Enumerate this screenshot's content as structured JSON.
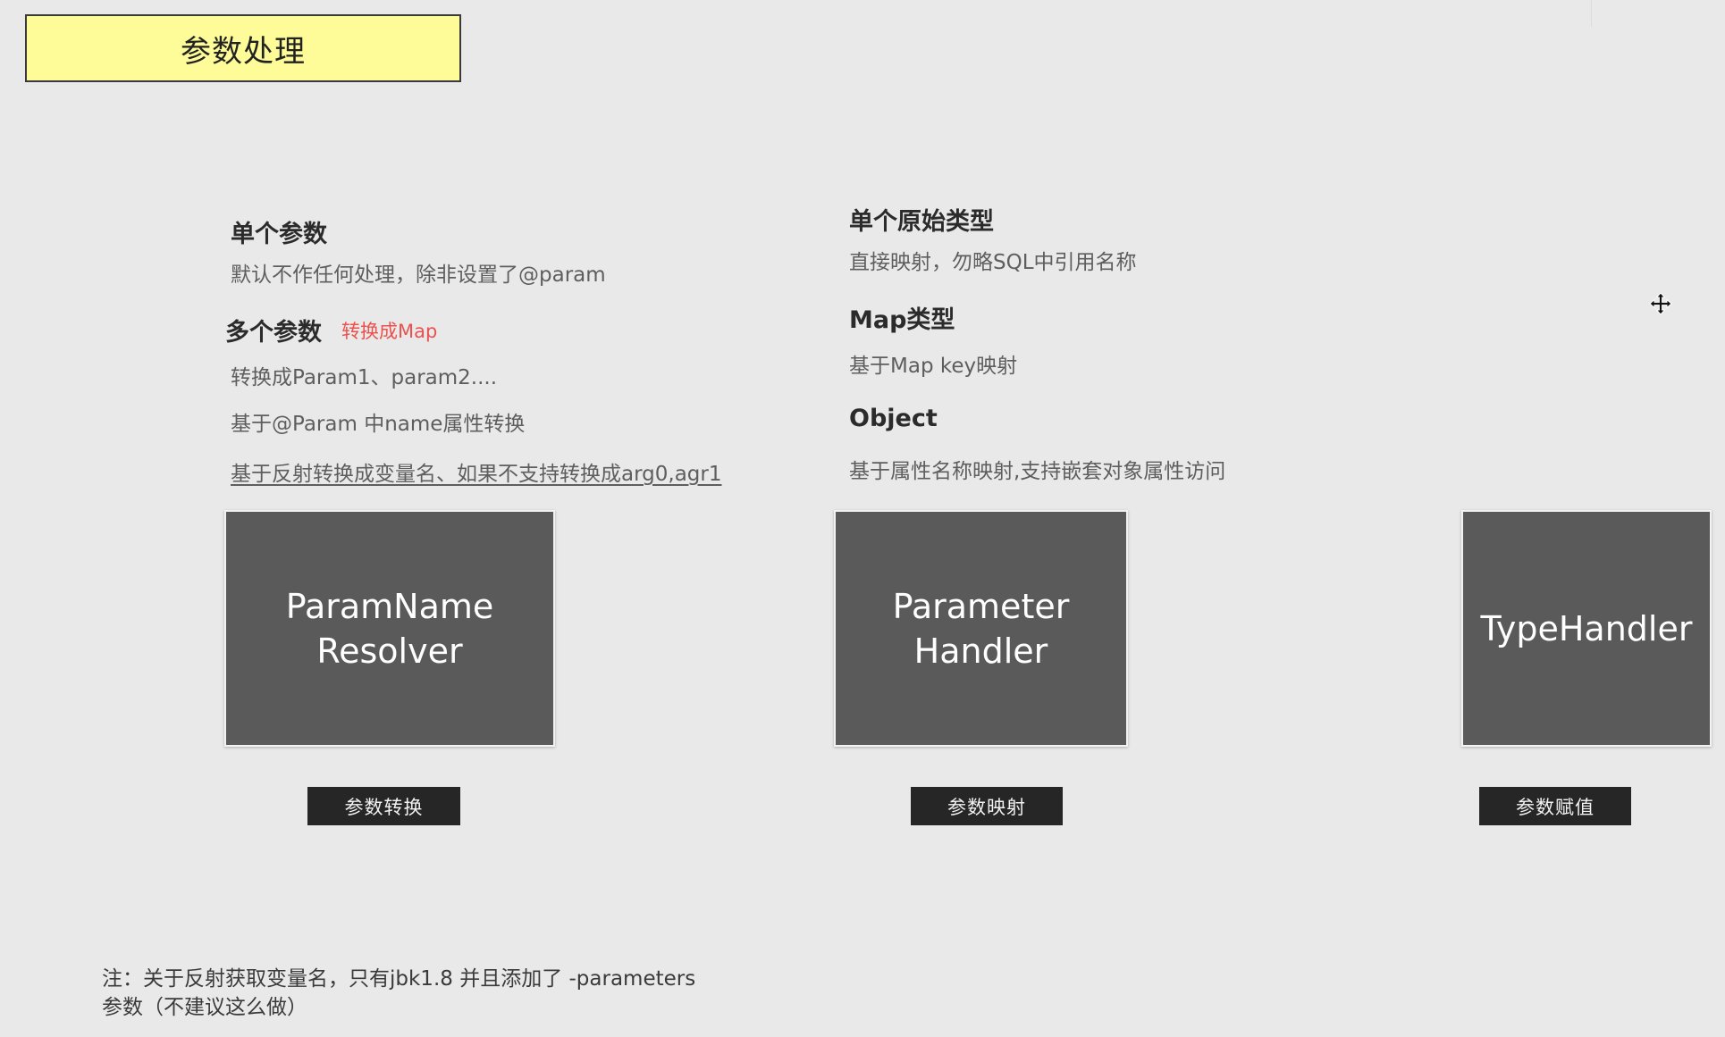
{
  "title": "参数处理",
  "left": {
    "single": {
      "heading": "单个参数",
      "desc": "默认不作任何处理，除非设置了@param"
    },
    "multi": {
      "heading": "多个参数",
      "tag": "转换成Map",
      "lines": [
        "转换成Param1、param2....",
        "基于@Param 中name属性转换",
        "基于反射转换成变量名、如果不支持转换成arg0,agr1"
      ]
    }
  },
  "middle": {
    "primitive": {
      "heading": "单个原始类型",
      "desc": "直接映射，勿略SQL中引用名称"
    },
    "map": {
      "heading": "Map类型",
      "desc": "基于Map key映射"
    },
    "object": {
      "heading": "Object",
      "desc": "基于属性名称映射,支持嵌套对象属性访问"
    }
  },
  "boxes": [
    {
      "line1": "ParamName",
      "line2": "Resolver"
    },
    {
      "line1": "Parameter",
      "line2": "Handler"
    },
    {
      "line1": "TypeHandler",
      "line2": ""
    }
  ],
  "buttons": [
    "参数转换",
    "参数映射",
    "参数赋值"
  ],
  "note": {
    "line1": "注：关于反射获取变量名，只有jbk1.8 并且添加了 -parameters",
    "line2": "参数（不建议这么做）"
  },
  "icons": {
    "move": "move-icon"
  },
  "colors": {
    "background": "#e9e9e9",
    "title_fill": "#fdfc98",
    "box_fill": "#5a5a5a",
    "button_fill": "#262626",
    "accent_red": "#e9524f"
  }
}
